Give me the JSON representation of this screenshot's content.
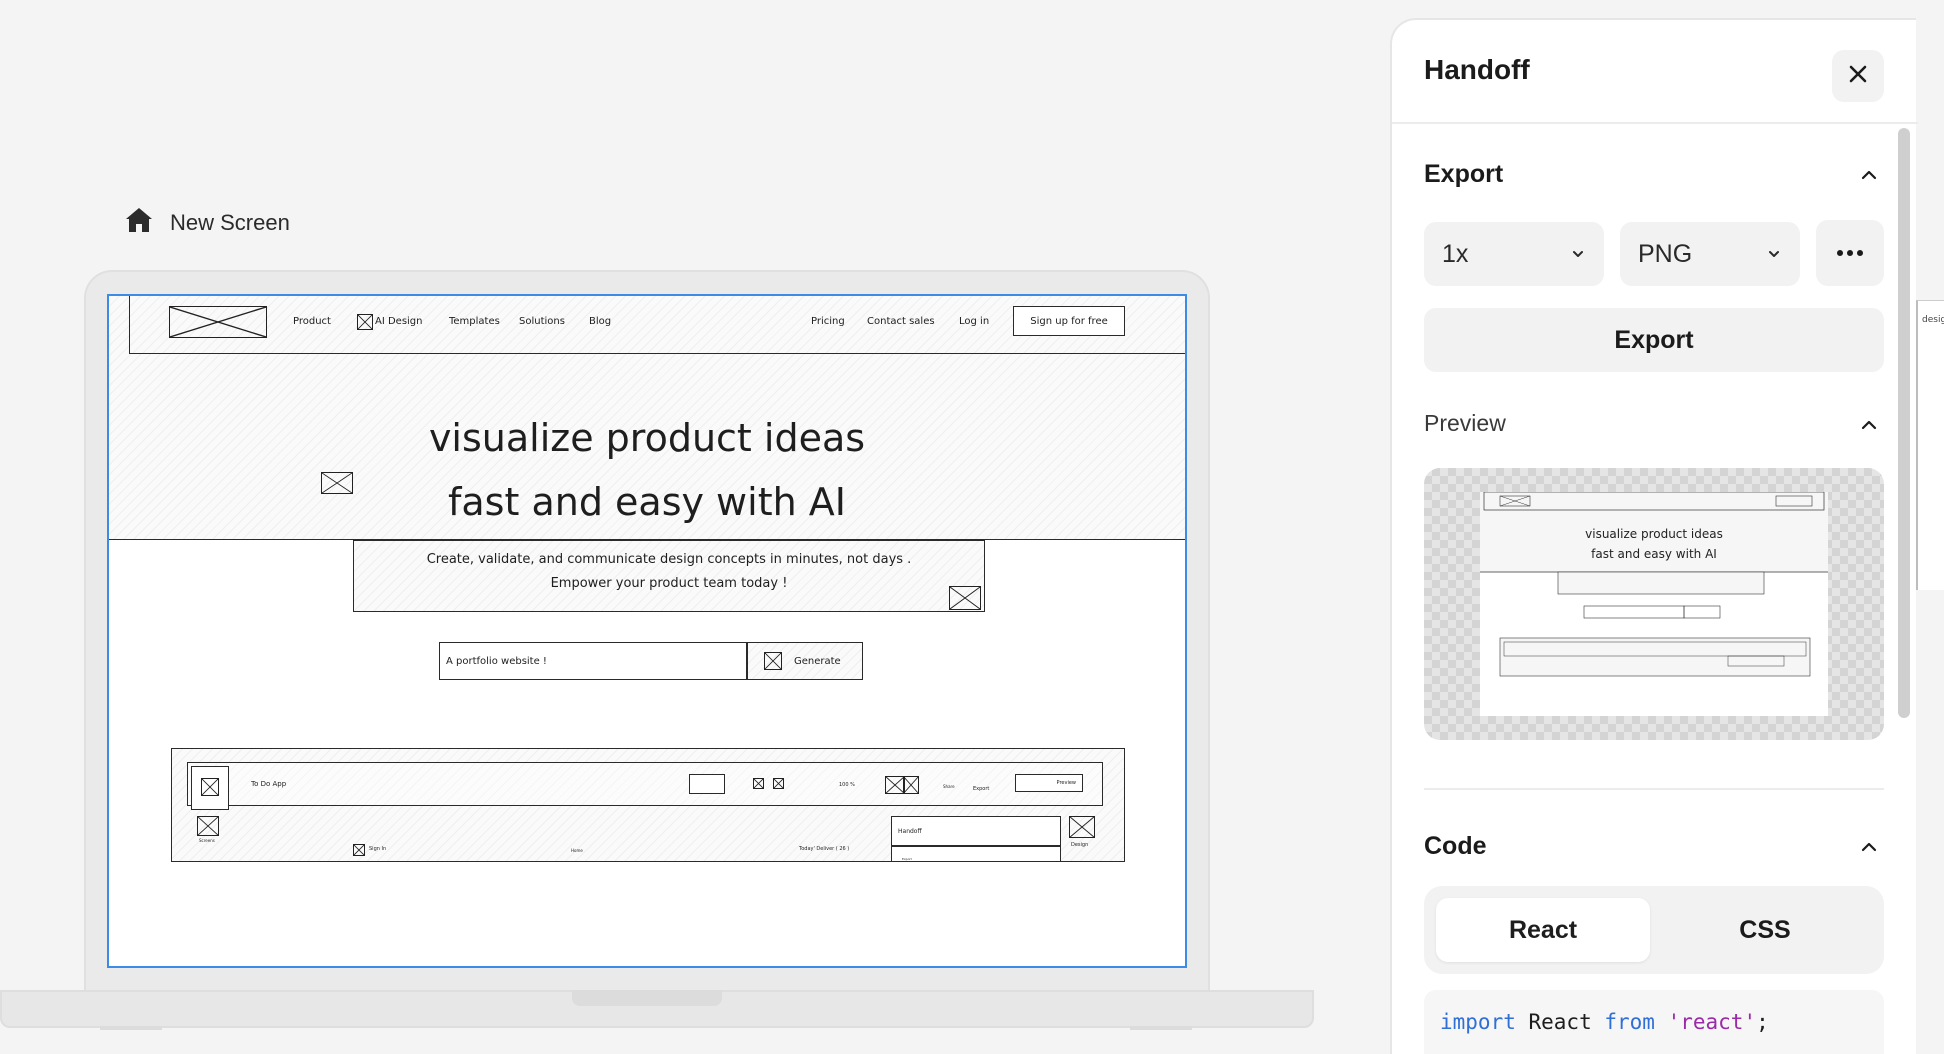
{
  "canvas": {
    "screen_label": "New Screen",
    "home_icon": "home-icon"
  },
  "mockup": {
    "nav": {
      "items": [
        "Product",
        "AI Design",
        "Templates",
        "Solutions",
        "Blog"
      ],
      "right_items": [
        "Pricing",
        "Contact sales",
        "Log in"
      ],
      "cta": "Sign up for free"
    },
    "hero": {
      "line1": "visualize product ideas",
      "line2": "fast and easy with AI"
    },
    "sub": {
      "line1": "Create, validate, and communicate design concepts in minutes, not days .",
      "line2": "Empower your product team today !"
    },
    "prompt": {
      "value": "A portfolio website !",
      "button": "Generate"
    },
    "app": {
      "title": "To Do App",
      "zoom": "100 %",
      "export": "Export",
      "preview": "Preview",
      "handoff": "Handoff",
      "design": "Design",
      "sign_in": "Sign In",
      "today": "Today' Deliver ( 26 )",
      "screens": "Screens",
      "home": "Home",
      "export_small": "Export",
      "share": "Share"
    }
  },
  "panel": {
    "title": "Handoff",
    "export": {
      "heading": "Export",
      "scale": "1x",
      "format": "PNG",
      "button": "Export"
    },
    "preview": {
      "heading": "Preview"
    },
    "code": {
      "heading": "Code",
      "tabs": [
        "React",
        "CSS"
      ],
      "active_tab": "React",
      "line": {
        "kw1": "import",
        "ident": " React ",
        "kw2": "from",
        "str": " 'react'",
        "end": ";"
      }
    }
  },
  "peek": {
    "text": "design"
  }
}
